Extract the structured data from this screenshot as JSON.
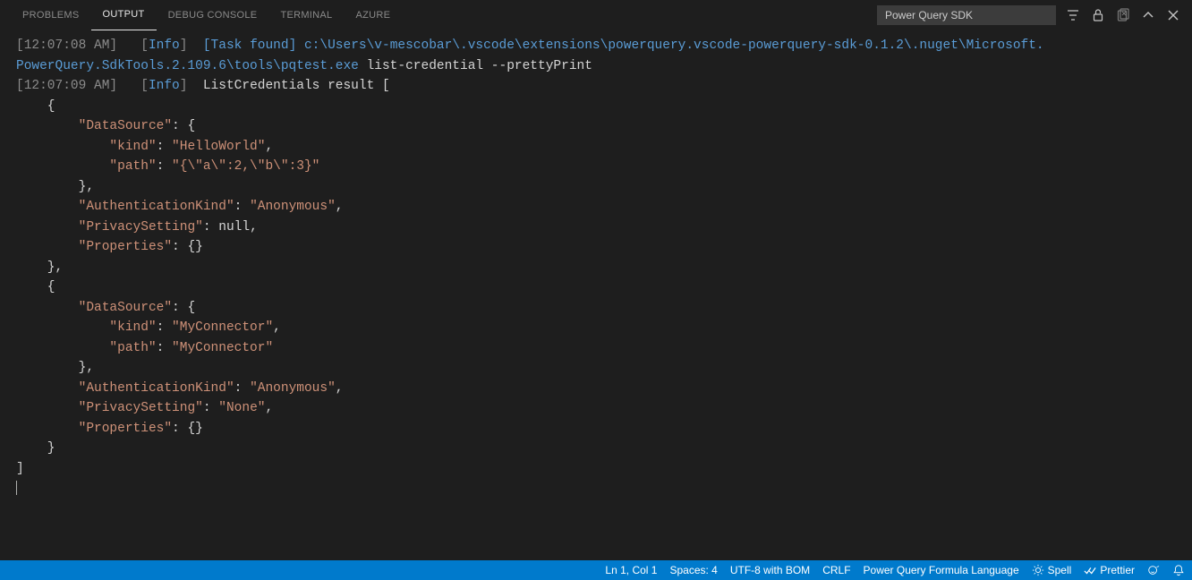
{
  "tabs": {
    "problems": "PROBLEMS",
    "output": "OUTPUT",
    "debug_console": "DEBUG CONSOLE",
    "terminal": "TERMINAL",
    "azure": "AZURE"
  },
  "dropdown": {
    "selected": "Power Query SDK"
  },
  "log": {
    "line1": {
      "ts": "[12:07:08 AM]",
      "info": "Info",
      "task": "[Task found]",
      "pathA": "c:\\Users\\v-mescobar\\.vscode\\extensions\\powerquery.vscode-powerquery-sdk-0.1.2\\.nuget\\Microsoft.",
      "pathB": "PowerQuery.SdkTools.2.109.6\\tools\\pqtest.exe",
      "args": " list-credential --prettyPrint"
    },
    "line2": {
      "ts": "[12:07:09 AM]",
      "info": "Info",
      "label": "ListCredentials result ["
    }
  },
  "result": [
    {
      "DataSource": {
        "kind": "HelloWorld",
        "path": "{\\\"a\\\":2,\\\"b\\\":3}"
      },
      "AuthenticationKind": "Anonymous",
      "PrivacySetting": null,
      "Properties": {}
    },
    {
      "DataSource": {
        "kind": "MyConnector",
        "path": "MyConnector"
      },
      "AuthenticationKind": "Anonymous",
      "PrivacySetting": "None",
      "Properties": {}
    }
  ],
  "status": {
    "pos": "Ln 1, Col 1",
    "spaces": "Spaces: 4",
    "encoding": "UTF-8 with BOM",
    "eol": "CRLF",
    "lang": "Power Query Formula Language",
    "spell": "Spell",
    "prettier": "Prettier"
  }
}
